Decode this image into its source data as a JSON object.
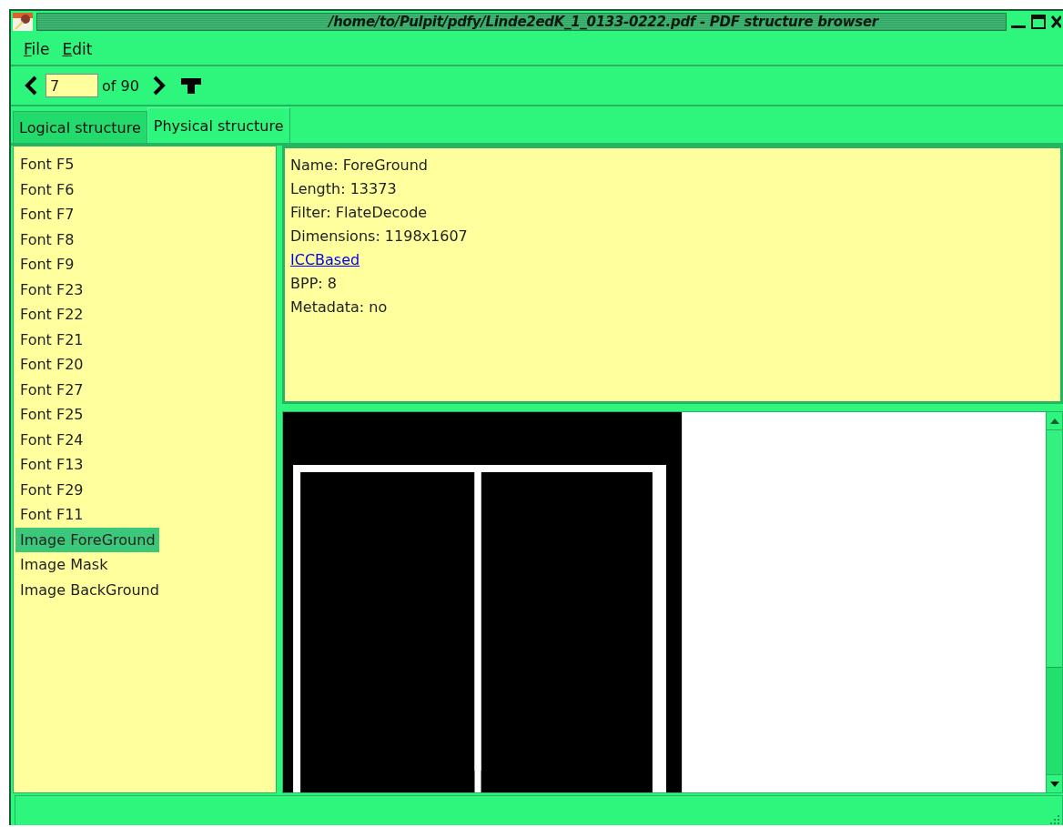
{
  "window": {
    "title": "/home/to/Pulpit/pdfy/Linde2edK_1_0133-0222.pdf - PDF structure browser"
  },
  "menu": [
    {
      "label": "File"
    },
    {
      "label": "Edit"
    }
  ],
  "toolbar": {
    "page_field": {
      "value": "7"
    },
    "page_count": "of 90"
  },
  "tabs": [
    {
      "label": "Logical structure",
      "selected": false
    },
    {
      "label": "Physical structure",
      "selected": true
    }
  ],
  "objects": [
    {
      "label": "Font F5",
      "selected": false
    },
    {
      "label": "Font F6",
      "selected": false
    },
    {
      "label": "Font F7",
      "selected": false
    },
    {
      "label": "Font F8",
      "selected": false
    },
    {
      "label": "Font F9",
      "selected": false
    },
    {
      "label": "Font F23",
      "selected": false
    },
    {
      "label": "Font F22",
      "selected": false
    },
    {
      "label": "Font F21",
      "selected": false
    },
    {
      "label": "Font F20",
      "selected": false
    },
    {
      "label": "Font F27",
      "selected": false
    },
    {
      "label": "Font F25",
      "selected": false
    },
    {
      "label": "Font F24",
      "selected": false
    },
    {
      "label": "Font F13",
      "selected": false
    },
    {
      "label": "Font F29",
      "selected": false
    },
    {
      "label": "Font F11",
      "selected": false
    },
    {
      "label": "Image ForeGround",
      "selected": true
    },
    {
      "label": "Image Mask",
      "selected": false
    },
    {
      "label": "Image BackGround",
      "selected": false
    }
  ],
  "details": [
    {
      "kind": "text",
      "text": "Name: ForeGround"
    },
    {
      "kind": "text",
      "text": "Length: 13373"
    },
    {
      "kind": "text",
      "text": "Filter: FlateDecode"
    },
    {
      "kind": "text",
      "text": "Dimensions: 1198x1607"
    },
    {
      "kind": "link",
      "text": "ICCBased"
    },
    {
      "kind": "text",
      "text": "BPP: 8"
    },
    {
      "kind": "text",
      "text": "Metadata: no"
    }
  ]
}
